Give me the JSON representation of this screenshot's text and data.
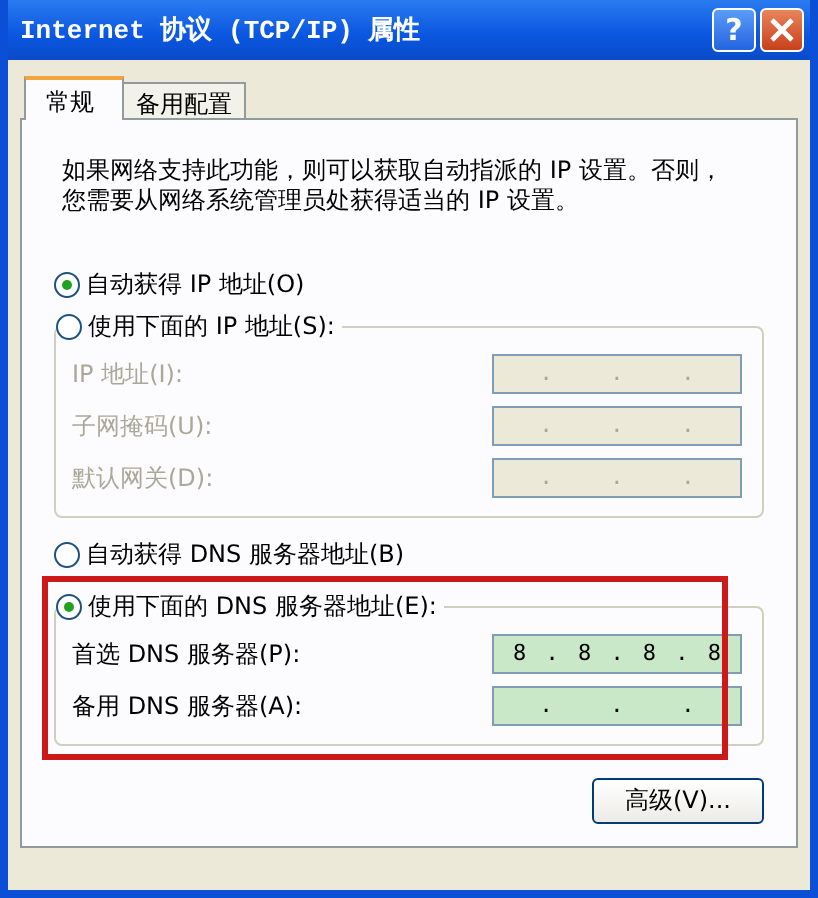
{
  "window": {
    "title": "Internet 协议 (TCP/IP) 属性",
    "help_button": "?"
  },
  "tabs": [
    {
      "label": "常规",
      "selected": true
    },
    {
      "label": "备用配置",
      "selected": false
    }
  ],
  "intro": [
    "如果网络支持此功能，则可以获取自动指派的 IP 设置。否则，",
    "您需要从网络系统管理员处获得适当的 IP 设置。"
  ],
  "ip_options": [
    {
      "label": "自动获得 IP 地址(O)",
      "selected": true
    },
    {
      "label": "使用下面的 IP 地址(S):",
      "selected": false
    }
  ],
  "ip_fields": [
    {
      "label": "IP 地址(I):",
      "value": ".   .   .",
      "disabled": true
    },
    {
      "label": "子网掩码(U):",
      "value": ".   .   .",
      "disabled": true
    },
    {
      "label": "默认网关(D):",
      "value": ".   .   .",
      "disabled": true
    }
  ],
  "dns_options": [
    {
      "label": "自动获得 DNS 服务器地址(B)",
      "selected": false
    },
    {
      "label": "使用下面的 DNS 服务器地址(E):",
      "selected": true
    }
  ],
  "dns_fields": [
    {
      "label": "首选 DNS 服务器(P):",
      "value": "8 . 8 . 8 . 8",
      "disabled": false
    },
    {
      "label": "备用 DNS 服务器(A):",
      "value": ".   .   .",
      "disabled": false
    }
  ],
  "dns_highlighted": true,
  "advanced_button": "高级(V)..."
}
